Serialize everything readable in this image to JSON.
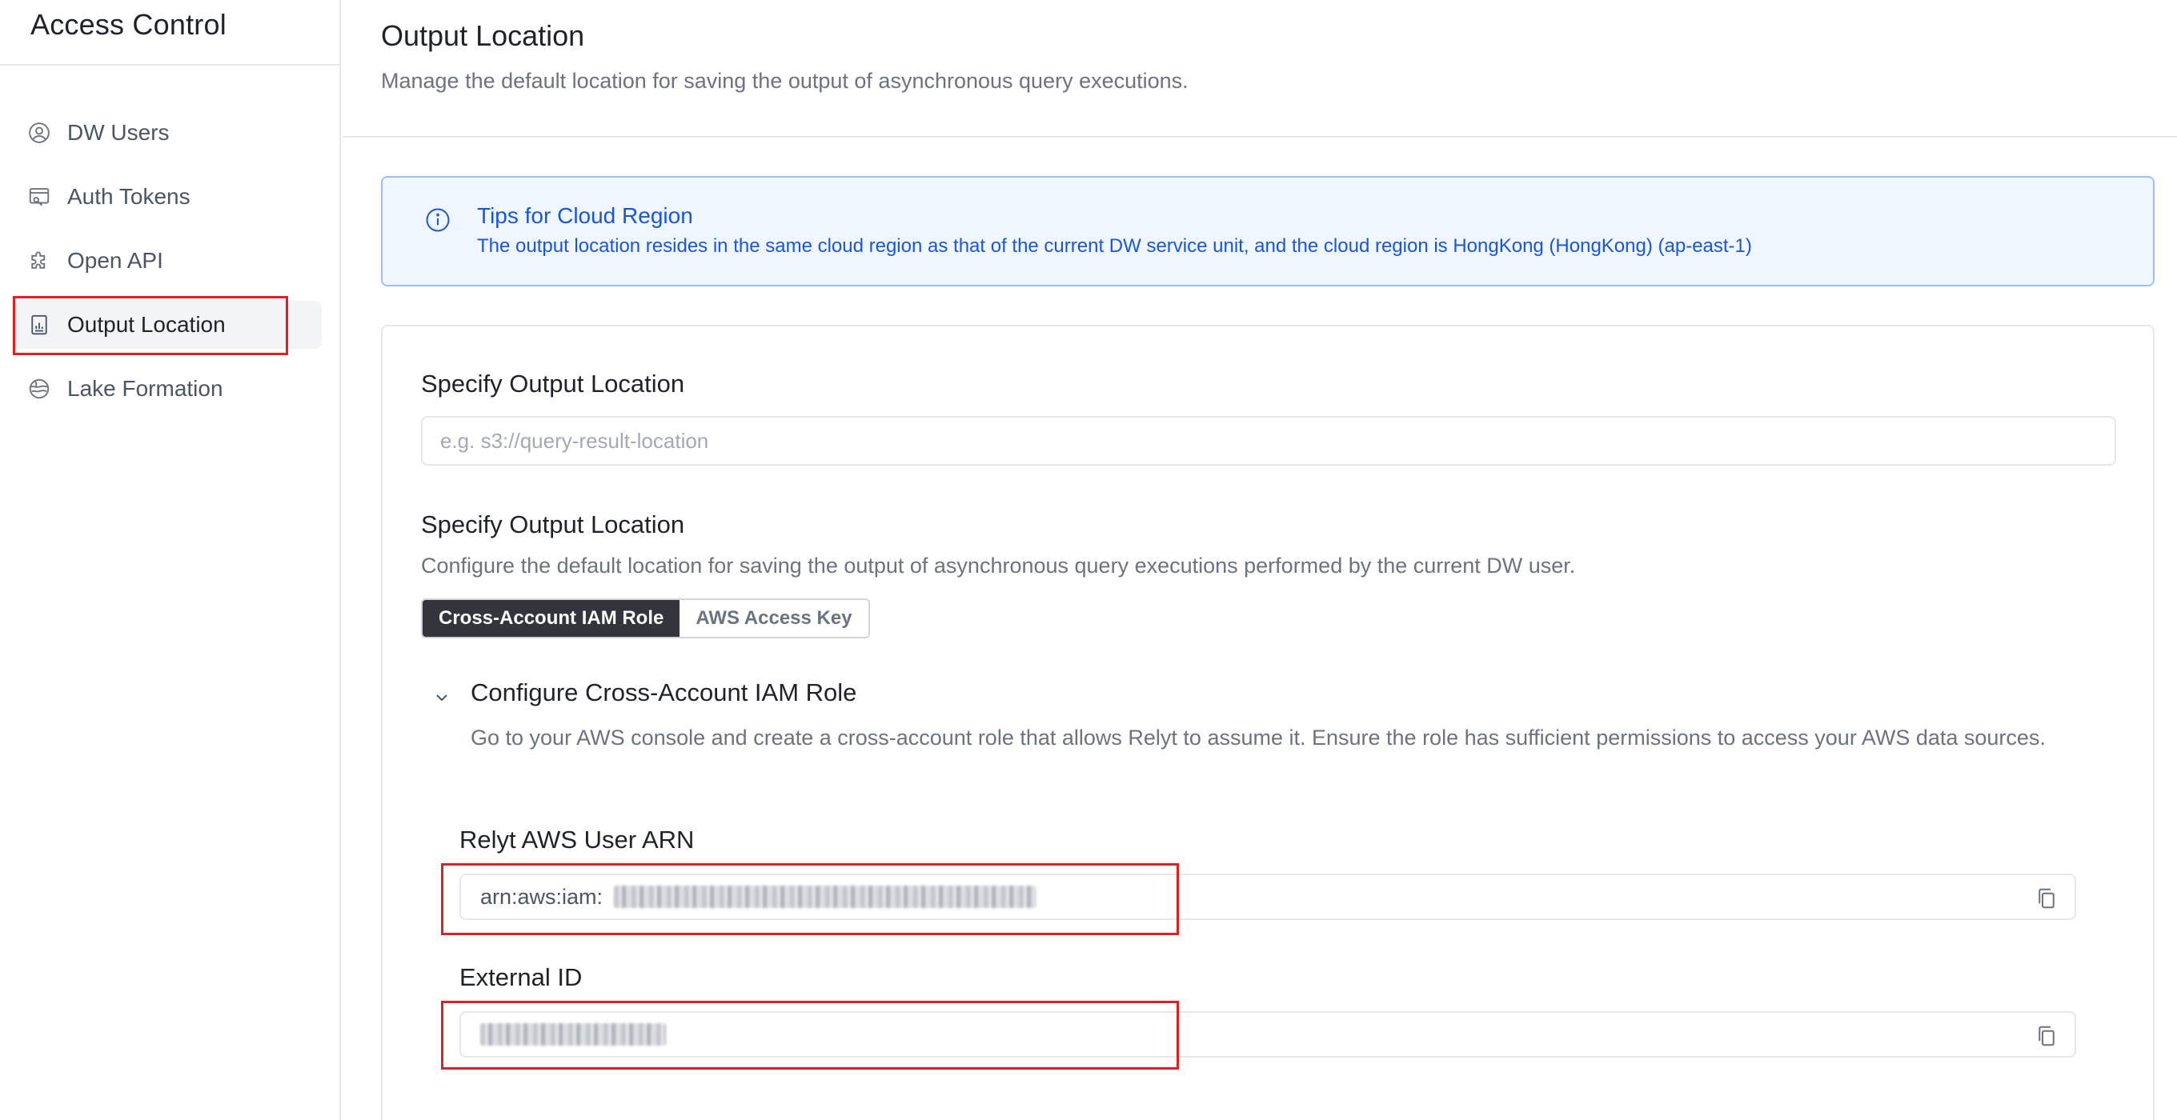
{
  "sidebar": {
    "title": "Access Control",
    "items": [
      {
        "label": "DW Users",
        "icon": "user-circle-icon",
        "active": false
      },
      {
        "label": "Auth Tokens",
        "icon": "token-card-icon",
        "active": false
      },
      {
        "label": "Open API",
        "icon": "puzzle-icon",
        "active": false
      },
      {
        "label": "Output Location",
        "icon": "report-file-icon",
        "active": true
      },
      {
        "label": "Lake Formation",
        "icon": "lake-globe-icon",
        "active": false
      }
    ]
  },
  "header": {
    "title": "Output Location",
    "description": "Manage the default location for saving the output of asynchronous query executions."
  },
  "tips": {
    "title": "Tips for Cloud Region",
    "text": "The output location resides in the same cloud region as that of the current DW service unit, and the cloud region is HongKong (HongKong) (ap-east-1)"
  },
  "form": {
    "location_label": "Specify Output Location",
    "location_placeholder": "e.g. s3://query-result-location",
    "location_value": "",
    "auth_label": "Specify Output Location",
    "auth_description": "Configure the default location for saving the output of asynchronous query executions performed by the current DW user.",
    "auth_options": [
      "Cross-Account IAM Role",
      "AWS Access Key"
    ],
    "auth_selected": "Cross-Account IAM Role",
    "section_title": "Configure Cross-Account IAM Role",
    "section_description": "Go to your AWS console and create a cross-account role that allows Relyt to assume it. Ensure the role has sufficient permissions to access your AWS data sources.",
    "arn_label": "Relyt AWS User ARN",
    "arn_prefix": "arn:aws:iam:",
    "external_id_label": "External ID"
  },
  "colors": {
    "accent": "#1a56db",
    "tips_bg": "#f0f6ff",
    "segment_active": "#32353b",
    "highlight": "#e02020"
  }
}
